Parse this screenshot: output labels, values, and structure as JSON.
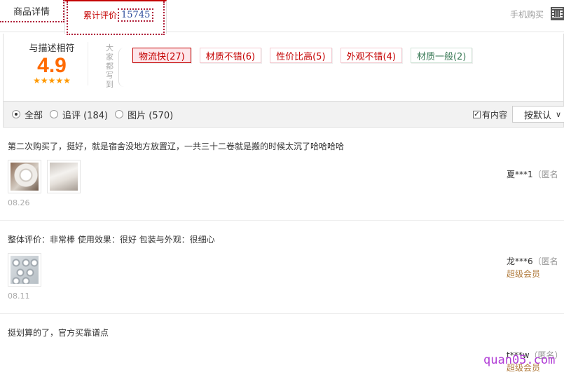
{
  "tabs": {
    "detail_label": "商品详情",
    "reviews_label": "累计评价",
    "reviews_count": "15745",
    "mobile_buy": "手机购买"
  },
  "rating": {
    "label": "与描述相符",
    "score": "4.9",
    "stars": 5,
    "vertical_label": "大家都写到",
    "tags": [
      {
        "label": "物流快(27)",
        "kind": "pos",
        "active": true
      },
      {
        "label": "材质不错(6)",
        "kind": "pos",
        "active": false
      },
      {
        "label": "性价比高(5)",
        "kind": "pos",
        "active": false
      },
      {
        "label": "外观不错(4)",
        "kind": "pos",
        "active": false
      },
      {
        "label": "材质一般(2)",
        "kind": "neutral",
        "active": false
      }
    ]
  },
  "filter": {
    "options": [
      {
        "label": "全部",
        "selected": true
      },
      {
        "label": "追评 (184)",
        "selected": false
      },
      {
        "label": "图片 (570)",
        "selected": false
      }
    ],
    "has_content_label": "有内容",
    "has_content_checked": true,
    "sort_label": "按默认"
  },
  "reviews": [
    {
      "text": "第二次购买了，挺好，就是宿舍没地方放置辽，一共三十二卷就是搬的时候太沉了哈哈哈哈",
      "images": [
        "toilet-roll-photo",
        "paper-photo"
      ],
      "date": "08.26",
      "user": "夏***1",
      "anon": "（匿名",
      "vip": ""
    },
    {
      "text": "整体评价：非常棒 使用效果：很好 包装与外观：很细心",
      "images": [
        "roll-pile-photo"
      ],
      "date": "08.11",
      "user": "龙***6",
      "anon": "（匿名",
      "vip": "超级会员"
    },
    {
      "text": "挺划算的了，官方买靠谱点",
      "images": [],
      "date": "",
      "user": "t***w",
      "anon": "（匿名）",
      "vip": "超级会员"
    }
  ],
  "watermark": "quan05.com",
  "colors": {
    "accent": "#c40000",
    "score": "#ff6a00",
    "star": "#ff9900",
    "vip": "#b07a3b",
    "count": "#2a4a9a"
  }
}
